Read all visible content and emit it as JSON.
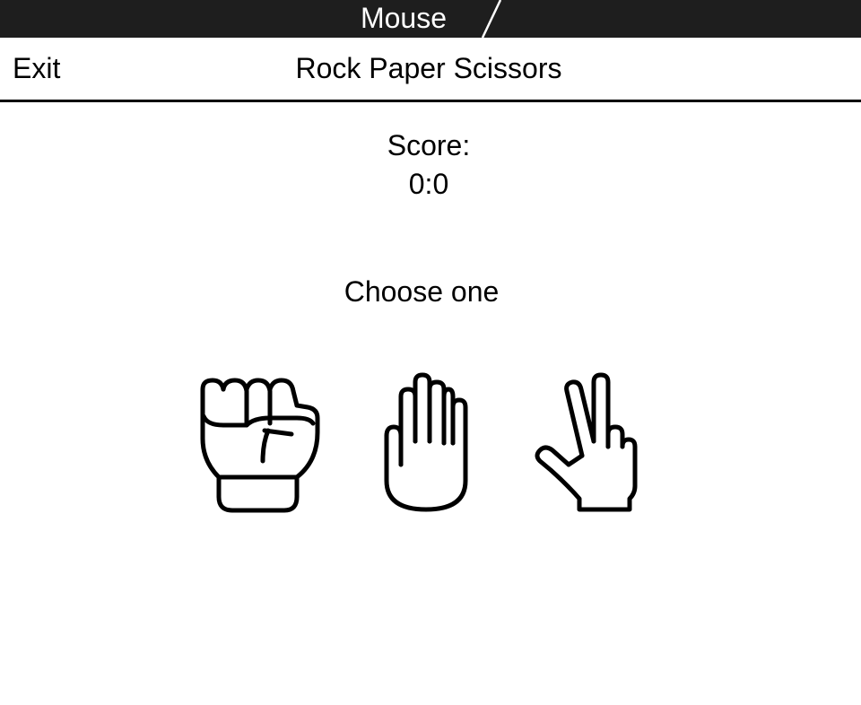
{
  "window": {
    "title": "Mouse"
  },
  "header": {
    "exit_label": "Exit",
    "title": "Rock Paper Scissors"
  },
  "score": {
    "label": "Score:",
    "value": "0:0"
  },
  "prompt": "Choose one",
  "choices": [
    {
      "name": "rock",
      "icon": "fist-icon"
    },
    {
      "name": "paper",
      "icon": "open-hand-icon"
    },
    {
      "name": "scissors",
      "icon": "peace-hand-icon"
    }
  ],
  "colors": {
    "topbar_bg": "#1e1e1e",
    "topbar_text": "#ffffff",
    "foreground": "#000000",
    "background": "#ffffff"
  }
}
